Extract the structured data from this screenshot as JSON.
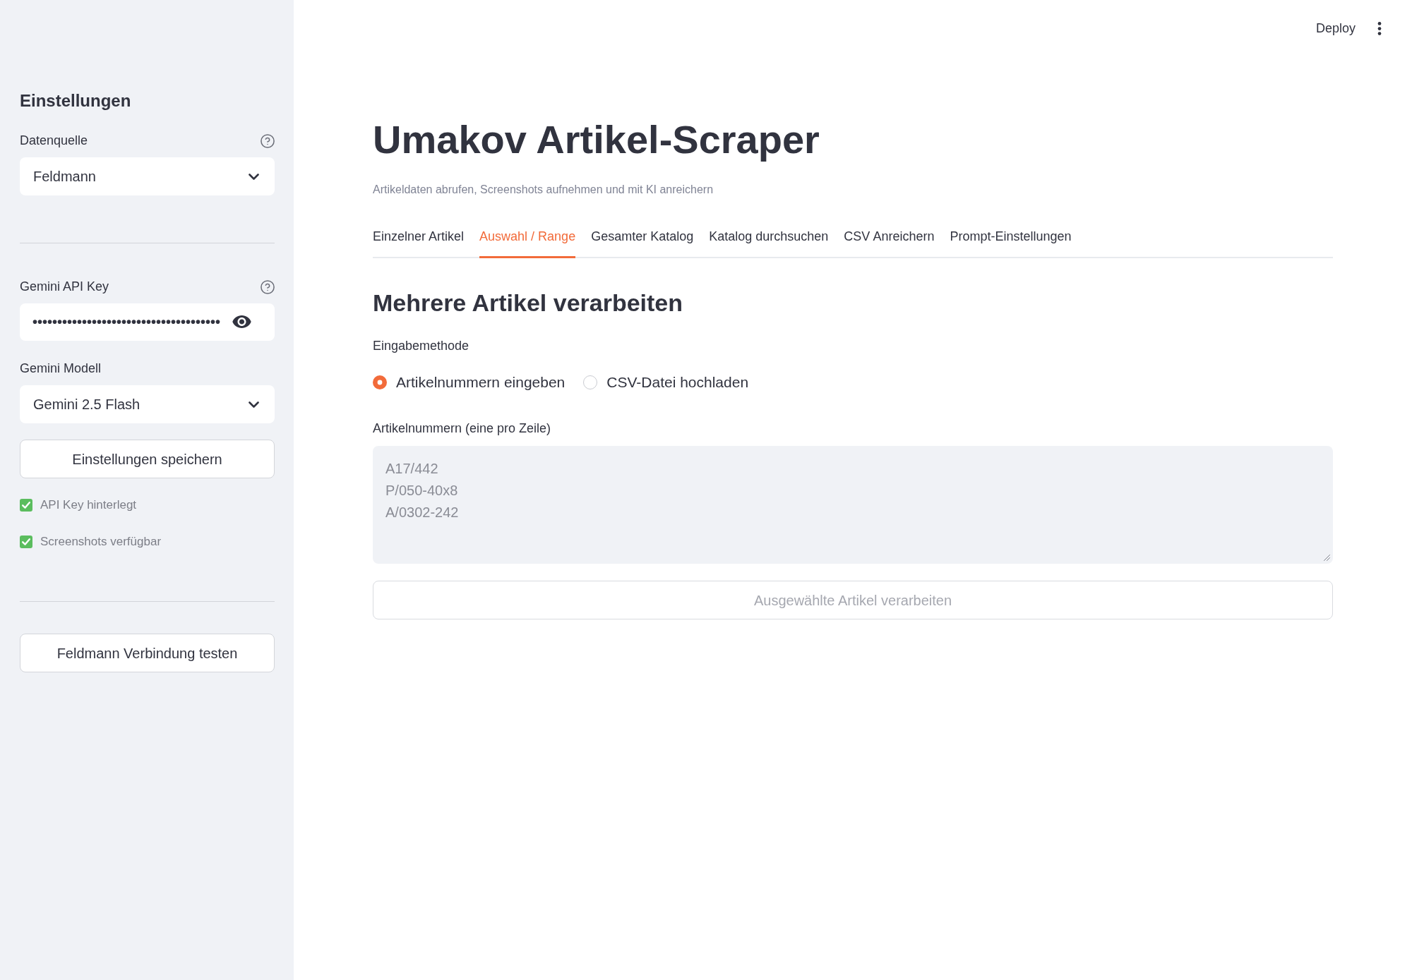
{
  "header": {
    "deploy_button": "Deploy"
  },
  "sidebar": {
    "title": "Einstellungen",
    "data_source": {
      "kind": "select",
      "label": "Datenquelle",
      "help": true,
      "value": "Feldmann"
    },
    "api_key": {
      "kind": "password",
      "label": "Gemini API Key",
      "help": true,
      "value": "••••••••••••••••••••••••••••••••••••••"
    },
    "model": {
      "kind": "select",
      "label": "Gemini Modell",
      "help": false,
      "value": "Gemini 2.5 Flash"
    },
    "save_button": "Einstellungen speichern",
    "status": [
      {
        "text": "API Key hinterlegt",
        "ok": true
      },
      {
        "text": "Screenshots verfügbar",
        "ok": true
      }
    ],
    "test_button": "Feldmann Verbindung testen"
  },
  "main": {
    "title": "Umakov Artikel-Scraper",
    "subtitle": "Artikeldaten abrufen, Screenshots aufnehmen und mit KI anreichern",
    "tabs": [
      {
        "label": "Einzelner Artikel",
        "selected": false
      },
      {
        "label": "Auswahl / Range",
        "selected": true
      },
      {
        "label": "Gesamter Katalog",
        "selected": false
      },
      {
        "label": "Katalog durchsuchen",
        "selected": false
      },
      {
        "label": "CSV Anreichern",
        "selected": false
      },
      {
        "label": "Prompt-Einstellungen",
        "selected": false
      }
    ],
    "section": {
      "heading": "Mehrere Artikel verarbeiten",
      "input_method": {
        "label": "Eingabemethode",
        "options": [
          {
            "label": "Artikelnummern eingeben",
            "selected": true
          },
          {
            "label": "CSV-Datei hochladen",
            "selected": false
          }
        ]
      },
      "article_numbers": {
        "label": "Artikelnummern (eine pro Zeile)",
        "placeholder": "A17/442\nP/050-40x8\nA/0302-242"
      },
      "process_button": {
        "label": "Ausgewählte Artikel verarbeiten",
        "disabled": true
      }
    }
  }
}
